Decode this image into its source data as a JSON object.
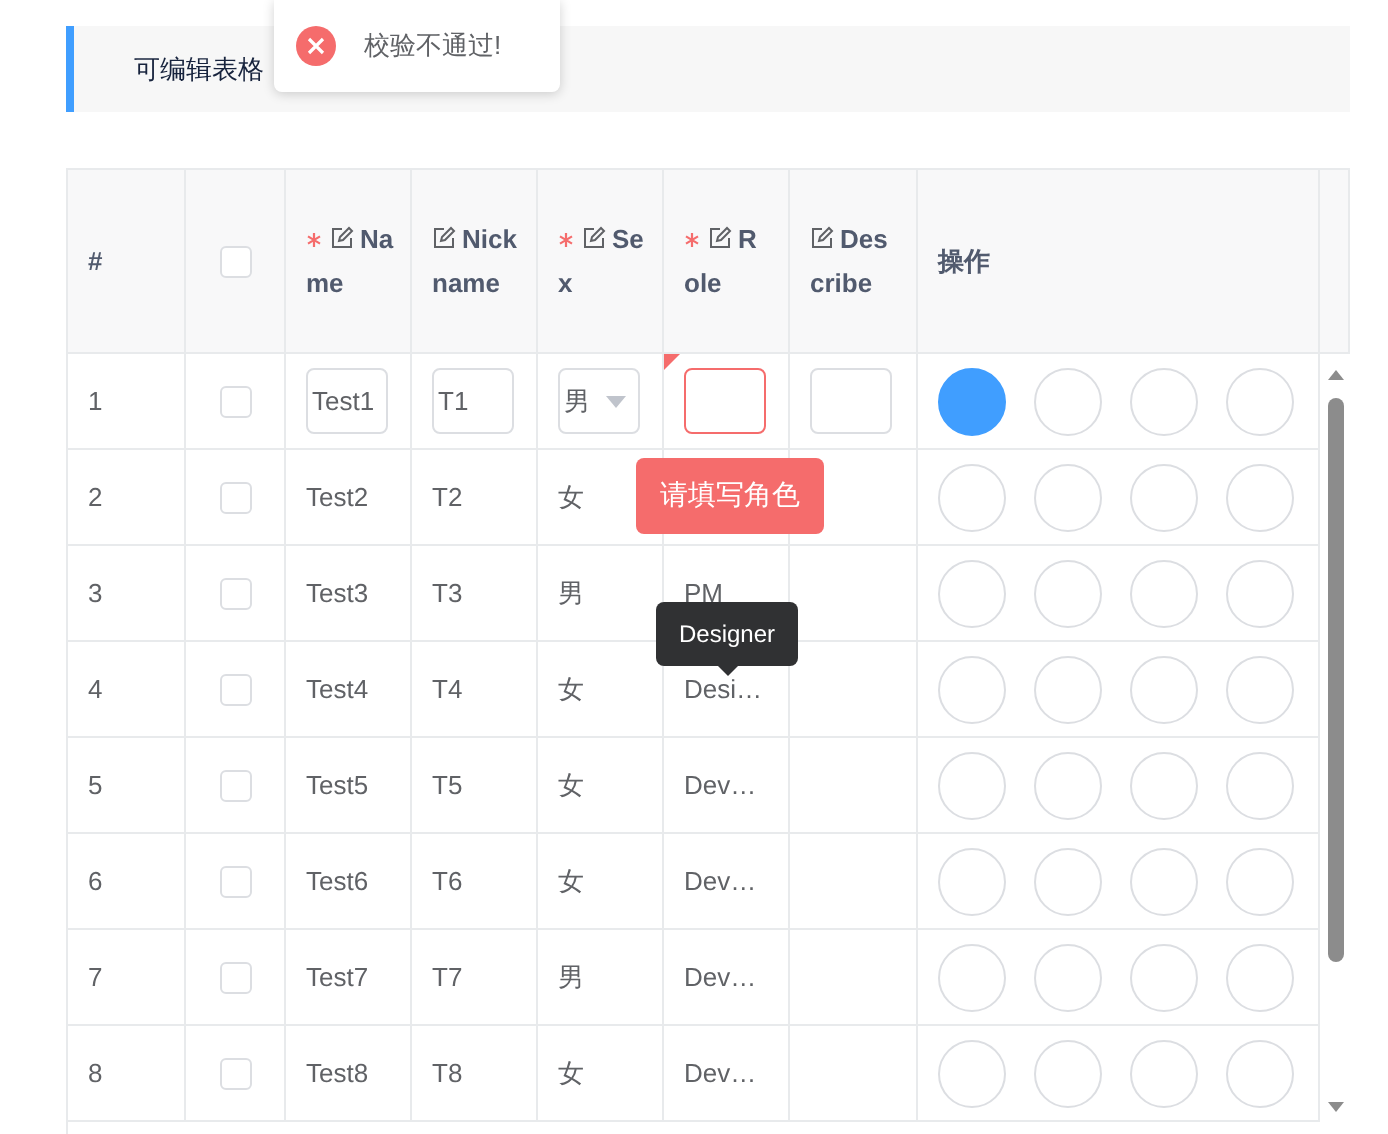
{
  "title": "可编辑表格",
  "toast": {
    "kind": "error",
    "text": "校验不通过!"
  },
  "columns": [
    {
      "kind": "text",
      "label": "#",
      "required": false,
      "editable": false
    },
    {
      "kind": "checkbox",
      "checked": false
    },
    {
      "kind": "text",
      "label": "Name",
      "required": true,
      "editable": true
    },
    {
      "kind": "text",
      "label": "Nickname",
      "required": false,
      "editable": true
    },
    {
      "kind": "text",
      "label": "Sex",
      "required": true,
      "editable": true
    },
    {
      "kind": "text",
      "label": "Role",
      "required": true,
      "editable": true
    },
    {
      "kind": "text",
      "label": "Describe",
      "required": false,
      "editable": true
    },
    {
      "kind": "text",
      "label": "操作",
      "required": false,
      "editable": false
    }
  ],
  "rows": [
    {
      "index": "1",
      "checked": false,
      "editing": true,
      "name": "Test1",
      "nickname": "T1",
      "sex": "男",
      "role": "",
      "role_invalid": true,
      "role_changed": true,
      "actions": [
        {
          "selected": true
        },
        {
          "selected": false
        },
        {
          "selected": false
        },
        {
          "selected": false
        }
      ]
    },
    {
      "index": "2",
      "checked": false,
      "editing": false,
      "name": "Test2",
      "nickname": "T2",
      "sex": "女",
      "role_invalid": false,
      "role_changed": false,
      "actions": [
        {
          "selected": false
        },
        {
          "selected": false
        },
        {
          "selected": false
        },
        {
          "selected": false
        }
      ]
    },
    {
      "index": "3",
      "checked": false,
      "editing": false,
      "name": "Test3",
      "nickname": "T3",
      "sex": "男",
      "role": "PM",
      "role_invalid": false,
      "role_changed": false,
      "actions": [
        {
          "selected": false
        },
        {
          "selected": false
        },
        {
          "selected": false
        },
        {
          "selected": false
        }
      ]
    },
    {
      "index": "4",
      "checked": false,
      "editing": false,
      "name": "Test4",
      "nickname": "T4",
      "sex": "女",
      "role": "Desi…",
      "role_invalid": false,
      "role_changed": false,
      "actions": [
        {
          "selected": false
        },
        {
          "selected": false
        },
        {
          "selected": false
        },
        {
          "selected": false
        }
      ]
    },
    {
      "index": "5",
      "checked": false,
      "editing": false,
      "name": "Test5",
      "nickname": "T5",
      "sex": "女",
      "role": "Dev…",
      "role_invalid": false,
      "role_changed": false,
      "actions": [
        {
          "selected": false
        },
        {
          "selected": false
        },
        {
          "selected": false
        },
        {
          "selected": false
        }
      ]
    },
    {
      "index": "6",
      "checked": false,
      "editing": false,
      "name": "Test6",
      "nickname": "T6",
      "sex": "女",
      "role": "Dev…",
      "role_invalid": false,
      "role_changed": false,
      "actions": [
        {
          "selected": false
        },
        {
          "selected": false
        },
        {
          "selected": false
        },
        {
          "selected": false
        }
      ]
    },
    {
      "index": "7",
      "checked": false,
      "editing": false,
      "name": "Test7",
      "nickname": "T7",
      "sex": "男",
      "role": "Dev…",
      "role_invalid": false,
      "role_changed": false,
      "actions": [
        {
          "selected": false
        },
        {
          "selected": false
        },
        {
          "selected": false
        },
        {
          "selected": false
        }
      ]
    },
    {
      "index": "8",
      "checked": false,
      "editing": false,
      "name": "Test8",
      "nickname": "T8",
      "sex": "女",
      "role": "Dev…",
      "role_invalid": false,
      "role_changed": false,
      "actions": [
        {
          "selected": false
        },
        {
          "selected": false
        },
        {
          "selected": false
        },
        {
          "selected": false
        }
      ]
    }
  ],
  "validation_tip": {
    "text": "请填写角色"
  },
  "hover_tip": {
    "text": "Designer"
  }
}
